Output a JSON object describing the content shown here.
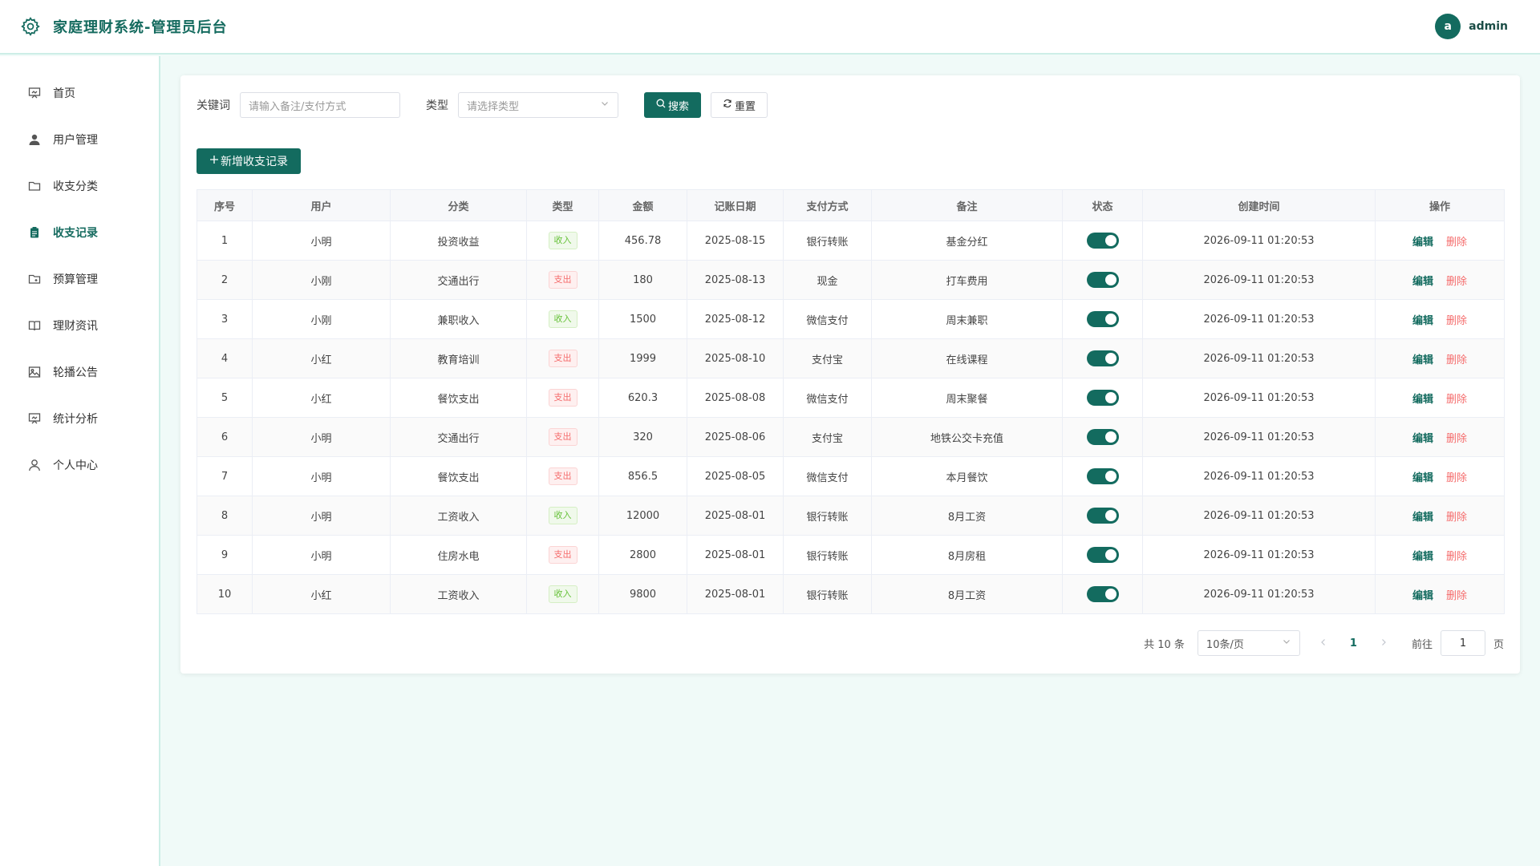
{
  "header": {
    "title": "家庭理财系统-管理员后台",
    "avatar_letter": "a",
    "username": "admin"
  },
  "sidebar": {
    "items": [
      {
        "label": "首页",
        "icon": "presentation-icon",
        "active": false
      },
      {
        "label": "用户管理",
        "icon": "user-icon",
        "active": false
      },
      {
        "label": "收支分类",
        "icon": "folder-icon",
        "active": false
      },
      {
        "label": "收支记录",
        "icon": "clipboard-icon",
        "active": true
      },
      {
        "label": "预算管理",
        "icon": "folder-add-icon",
        "active": false
      },
      {
        "label": "理财资讯",
        "icon": "book-icon",
        "active": false
      },
      {
        "label": "轮播公告",
        "icon": "image-icon",
        "active": false
      },
      {
        "label": "统计分析",
        "icon": "chart-board-icon",
        "active": false
      },
      {
        "label": "个人中心",
        "icon": "person-icon",
        "active": false
      }
    ]
  },
  "search": {
    "keyword_label": "关键词",
    "keyword_placeholder": "请输入备注/支付方式",
    "type_label": "类型",
    "type_placeholder": "请选择类型",
    "search_btn": "搜索",
    "reset_btn": "重置"
  },
  "add_btn": "新增收支记录",
  "table": {
    "columns": [
      "序号",
      "用户",
      "分类",
      "类型",
      "金额",
      "记账日期",
      "支付方式",
      "备注",
      "状态",
      "创建时间",
      "操作"
    ],
    "edit_label": "编辑",
    "delete_label": "删除",
    "rows": [
      {
        "id": "1",
        "user": "小明",
        "category": "投资收益",
        "type": "收入",
        "type_kind": "in",
        "amount": "456.78",
        "date": "2025-08-15",
        "pay": "银行转账",
        "note": "基金分红",
        "status": true,
        "created": "2026-09-11 01:20:53"
      },
      {
        "id": "2",
        "user": "小刚",
        "category": "交通出行",
        "type": "支出",
        "type_kind": "out",
        "amount": "180",
        "date": "2025-08-13",
        "pay": "现金",
        "note": "打车费用",
        "status": true,
        "created": "2026-09-11 01:20:53"
      },
      {
        "id": "3",
        "user": "小刚",
        "category": "兼职收入",
        "type": "收入",
        "type_kind": "in",
        "amount": "1500",
        "date": "2025-08-12",
        "pay": "微信支付",
        "note": "周末兼职",
        "status": true,
        "created": "2026-09-11 01:20:53"
      },
      {
        "id": "4",
        "user": "小红",
        "category": "教育培训",
        "type": "支出",
        "type_kind": "out",
        "amount": "1999",
        "date": "2025-08-10",
        "pay": "支付宝",
        "note": "在线课程",
        "status": true,
        "created": "2026-09-11 01:20:53"
      },
      {
        "id": "5",
        "user": "小红",
        "category": "餐饮支出",
        "type": "支出",
        "type_kind": "out",
        "amount": "620.3",
        "date": "2025-08-08",
        "pay": "微信支付",
        "note": "周末聚餐",
        "status": true,
        "created": "2026-09-11 01:20:53"
      },
      {
        "id": "6",
        "user": "小明",
        "category": "交通出行",
        "type": "支出",
        "type_kind": "out",
        "amount": "320",
        "date": "2025-08-06",
        "pay": "支付宝",
        "note": "地铁公交卡充值",
        "status": true,
        "created": "2026-09-11 01:20:53"
      },
      {
        "id": "7",
        "user": "小明",
        "category": "餐饮支出",
        "type": "支出",
        "type_kind": "out",
        "amount": "856.5",
        "date": "2025-08-05",
        "pay": "微信支付",
        "note": "本月餐饮",
        "status": true,
        "created": "2026-09-11 01:20:53"
      },
      {
        "id": "8",
        "user": "小明",
        "category": "工资收入",
        "type": "收入",
        "type_kind": "in",
        "amount": "12000",
        "date": "2025-08-01",
        "pay": "银行转账",
        "note": "8月工资",
        "status": true,
        "created": "2026-09-11 01:20:53"
      },
      {
        "id": "9",
        "user": "小明",
        "category": "住房水电",
        "type": "支出",
        "type_kind": "out",
        "amount": "2800",
        "date": "2025-08-01",
        "pay": "银行转账",
        "note": "8月房租",
        "status": true,
        "created": "2026-09-11 01:20:53"
      },
      {
        "id": "10",
        "user": "小红",
        "category": "工资收入",
        "type": "收入",
        "type_kind": "in",
        "amount": "9800",
        "date": "2025-08-01",
        "pay": "银行转账",
        "note": "8月工资",
        "status": true,
        "created": "2026-09-11 01:20:53"
      }
    ]
  },
  "pagination": {
    "total_text": "共 10 条",
    "page_size": "10条/页",
    "current_page": "1",
    "goto_label": "前往",
    "goto_value": "1",
    "page_suffix": "页"
  },
  "colors": {
    "primary": "#136b5f",
    "danger": "#f56c6c",
    "success": "#67c23a"
  }
}
